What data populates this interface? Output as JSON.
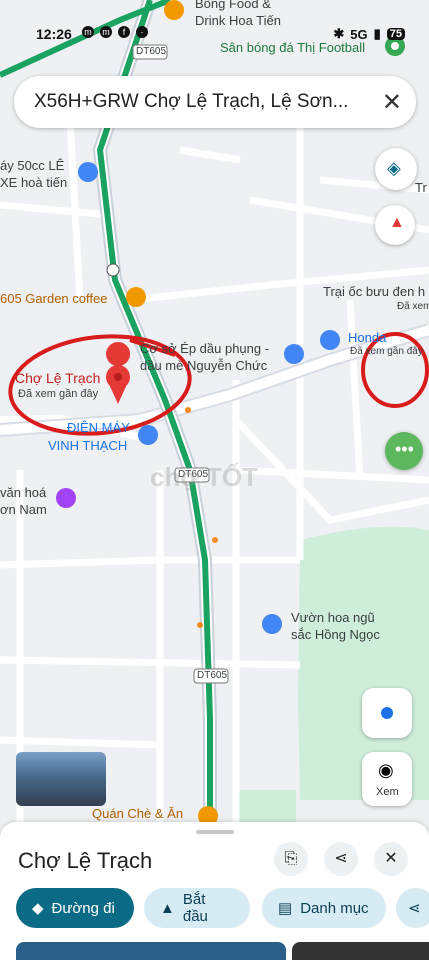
{
  "status_bar": {
    "time": "12:26",
    "network": "5G",
    "battery": "75"
  },
  "search": {
    "query": "X56H+GRW Chợ Lệ Trạch, Lệ Sơn..."
  },
  "map": {
    "labels": {
      "bong_food_1": "Bông Food &",
      "bong_food_2": "Drink Hoa Tiến",
      "san_bong": "Sân bóng đá Thị Football",
      "xe_may_1": "áy 50cc LÊ",
      "xe_may_2": "XE hoà tiến",
      "garden_coffee": "605 Garden coffee",
      "trai_oc_1": "Trại ốc bưu đen h",
      "trai_oc_2": "Đã xem",
      "honda_1": "Honda",
      "honda_2": "Đã xem gần đây",
      "co_so_1": "Cơ sở Ép dầu phụng -",
      "co_so_2": "dầu mè Nguyễn Chức",
      "cho_title": "Chợ Lệ Trạch",
      "cho_sub": "Đã xem gần đây",
      "dien_may_1": "ĐIỆN MÁY",
      "dien_may_2": "VINH THẠCH",
      "van_hoa_1": "văn hoá",
      "van_hoa_2": "ơn Nam",
      "vuon_hoa_1": "Vườn hoa ngũ",
      "vuon_hoa_2": "sắc Hồng Ngọc",
      "quan_che": "Quán Chè & Ăn",
      "tr": "Tr",
      "road_1": "DT605",
      "road_2": "DT605",
      "road_3": "DT605",
      "watermark": "chợ TỐT",
      "xem": "Xem"
    }
  },
  "sheet": {
    "title": "Chợ Lệ Trạch",
    "chips": {
      "directions": "Đường đi",
      "start": "Bắt đầu",
      "menu": "Danh mục"
    }
  },
  "colors": {
    "route": "#1aa260",
    "annotation": "#d81b1b",
    "accent": "#0b6b86",
    "park": "#cfeeda"
  }
}
